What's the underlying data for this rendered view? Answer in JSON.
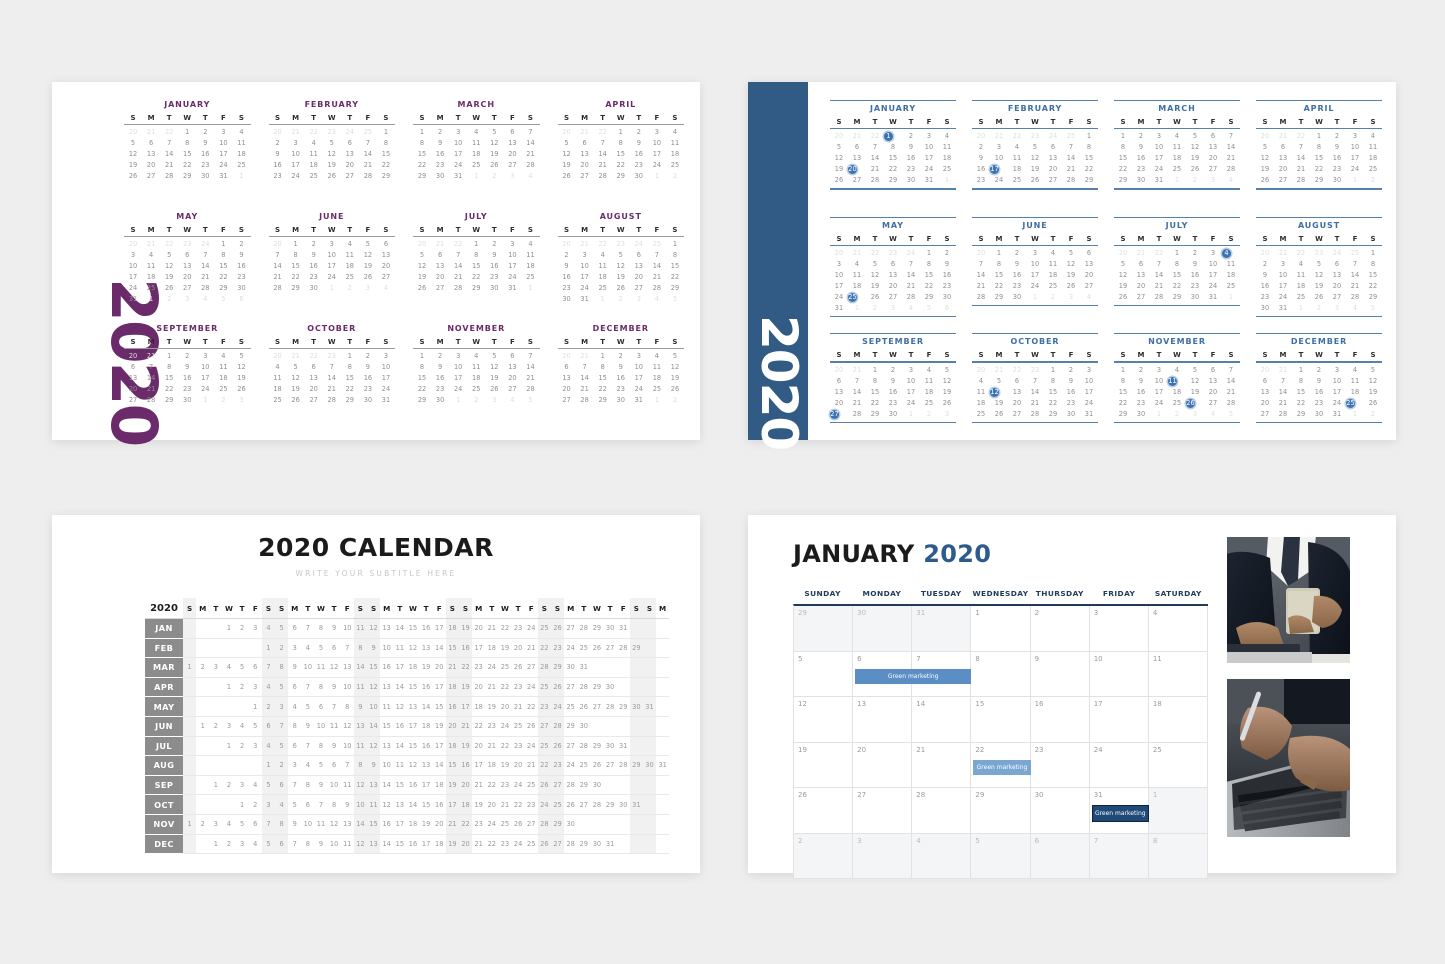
{
  "page": {
    "background": "#eeeeee",
    "accent_purple": "#6b2b6b",
    "accent_blue": "#315b85",
    "highlight_blue": "#3b74b4",
    "navy": "#1f3a5a"
  },
  "dow_short": [
    "S",
    "M",
    "T",
    "W",
    "T",
    "F",
    "S"
  ],
  "year_purple": {
    "year_label": "2020",
    "months": [
      {
        "name": "JANUARY",
        "lead": 3,
        "days": 31,
        "trail": 1
      },
      {
        "name": "FEBRUARY",
        "lead": 6,
        "days": 29,
        "trail": 0
      },
      {
        "name": "MARCH",
        "lead": 0,
        "days": 31,
        "trail": 4
      },
      {
        "name": "APRIL",
        "lead": 3,
        "days": 30,
        "trail": 2
      },
      {
        "name": "MAY",
        "lead": 5,
        "days": 31,
        "trail": 6
      },
      {
        "name": "JUNE",
        "lead": 1,
        "days": 30,
        "trail": 4
      },
      {
        "name": "JULY",
        "lead": 3,
        "days": 31,
        "trail": 1
      },
      {
        "name": "AUGUST",
        "lead": 6,
        "days": 31,
        "trail": 5
      },
      {
        "name": "SEPTEMBER",
        "lead": 2,
        "days": 30,
        "trail": 3
      },
      {
        "name": "OCTOBER",
        "lead": 4,
        "days": 31,
        "trail": 0
      },
      {
        "name": "NOVEMBER",
        "lead": 0,
        "days": 30,
        "trail": 5
      },
      {
        "name": "DECEMBER",
        "lead": 2,
        "days": 31,
        "trail": 2
      }
    ]
  },
  "year_blue": {
    "year_label": "2020",
    "months": [
      {
        "name": "JANUARY",
        "lead": 3,
        "days": 31,
        "trail": 1,
        "highlight": [
          1,
          20
        ]
      },
      {
        "name": "FEBRUARY",
        "lead": 6,
        "days": 29,
        "trail": 0,
        "highlight": [
          17
        ]
      },
      {
        "name": "MARCH",
        "lead": 0,
        "days": 31,
        "trail": 4,
        "highlight": []
      },
      {
        "name": "APRIL",
        "lead": 3,
        "days": 30,
        "trail": 2,
        "highlight": []
      },
      {
        "name": "MAY",
        "lead": 5,
        "days": 31,
        "trail": 6,
        "highlight": [
          25
        ]
      },
      {
        "name": "JUNE",
        "lead": 1,
        "days": 30,
        "trail": 4,
        "highlight": []
      },
      {
        "name": "JULY",
        "lead": 3,
        "days": 31,
        "trail": 1,
        "highlight": [
          4
        ]
      },
      {
        "name": "AUGUST",
        "lead": 6,
        "days": 31,
        "trail": 5,
        "highlight": []
      },
      {
        "name": "SEPTEMBER",
        "lead": 2,
        "days": 30,
        "trail": 3,
        "highlight": [
          27
        ]
      },
      {
        "name": "OCTOBER",
        "lead": 4,
        "days": 31,
        "trail": 0,
        "highlight": [
          12
        ]
      },
      {
        "name": "NOVEMBER",
        "lead": 0,
        "days": 30,
        "trail": 5,
        "highlight": [
          11,
          26
        ]
      },
      {
        "name": "DECEMBER",
        "lead": 2,
        "days": 31,
        "trail": 2,
        "highlight": [
          25
        ]
      }
    ]
  },
  "linear": {
    "title": "2020 CALENDAR",
    "subtitle": "WRITE YOUR SUBTITLE HERE",
    "corner_label": "2020",
    "columns": 37,
    "header_dow": [
      "S",
      "M",
      "T",
      "W",
      "T",
      "F",
      "S",
      "S",
      "M",
      "T",
      "W",
      "T",
      "F",
      "S",
      "S",
      "M",
      "T",
      "W",
      "T",
      "F",
      "S",
      "S",
      "M",
      "T",
      "W",
      "T",
      "F",
      "S",
      "S",
      "M",
      "T",
      "W",
      "T",
      "F",
      "S",
      "S",
      "M"
    ],
    "rows": [
      {
        "label": "JAN",
        "start": 3,
        "days": 31
      },
      {
        "label": "FEB",
        "start": 6,
        "days": 29
      },
      {
        "label": "MAR",
        "start": 0,
        "days": 31
      },
      {
        "label": "APR",
        "start": 3,
        "days": 30
      },
      {
        "label": "MAY",
        "start": 5,
        "days": 31
      },
      {
        "label": "JUN",
        "start": 1,
        "days": 30
      },
      {
        "label": "JUL",
        "start": 3,
        "days": 31
      },
      {
        "label": "AUG",
        "start": 6,
        "days": 31
      },
      {
        "label": "SEP",
        "start": 2,
        "days": 30
      },
      {
        "label": "OCT",
        "start": 4,
        "days": 31
      },
      {
        "label": "NOV",
        "start": 0,
        "days": 30
      },
      {
        "label": "DEC",
        "start": 2,
        "days": 31
      }
    ]
  },
  "month_view": {
    "month_label": "JANUARY",
    "year_label": "2020",
    "dow_full": [
      "SUNDAY",
      "MONDAY",
      "TUESDAY",
      "WEDNESDAY",
      "THURSDAY",
      "FRIDAY",
      "SATURDAY"
    ],
    "weeks": [
      [
        {
          "n": "29",
          "muted": true
        },
        {
          "n": "30",
          "muted": true
        },
        {
          "n": "31",
          "muted": true
        },
        {
          "n": "1"
        },
        {
          "n": "2"
        },
        {
          "n": "3"
        },
        {
          "n": "4"
        }
      ],
      [
        {
          "n": "5"
        },
        {
          "n": "6",
          "event": {
            "label": "Green marketing",
            "style": "mid",
            "span2": true
          }
        },
        {
          "n": "7"
        },
        {
          "n": "8"
        },
        {
          "n": "9"
        },
        {
          "n": "10"
        },
        {
          "n": "11"
        }
      ],
      [
        {
          "n": "12"
        },
        {
          "n": "13"
        },
        {
          "n": "14"
        },
        {
          "n": "15"
        },
        {
          "n": "16"
        },
        {
          "n": "17"
        },
        {
          "n": "18"
        }
      ],
      [
        {
          "n": "19"
        },
        {
          "n": "20"
        },
        {
          "n": "21"
        },
        {
          "n": "22",
          "event": {
            "label": "Green marketing",
            "style": "light"
          }
        },
        {
          "n": "23"
        },
        {
          "n": "24"
        },
        {
          "n": "25"
        }
      ],
      [
        {
          "n": "26"
        },
        {
          "n": "27"
        },
        {
          "n": "28"
        },
        {
          "n": "29"
        },
        {
          "n": "30"
        },
        {
          "n": "31",
          "event": {
            "label": "Green marketing",
            "style": "dark"
          }
        },
        {
          "n": "1",
          "muted": true
        }
      ],
      [
        {
          "n": "2",
          "muted": true
        },
        {
          "n": "3",
          "muted": true
        },
        {
          "n": "4",
          "muted": true
        },
        {
          "n": "5",
          "muted": true
        },
        {
          "n": "6",
          "muted": true
        },
        {
          "n": "7",
          "muted": true
        },
        {
          "n": "8",
          "muted": true
        }
      ]
    ],
    "photos": [
      {
        "name": "photo-business-phone",
        "alt": "person in suit using smartphone at laptop"
      },
      {
        "name": "photo-typing-laptop",
        "alt": "hands typing on laptop keyboard with pen"
      }
    ]
  }
}
